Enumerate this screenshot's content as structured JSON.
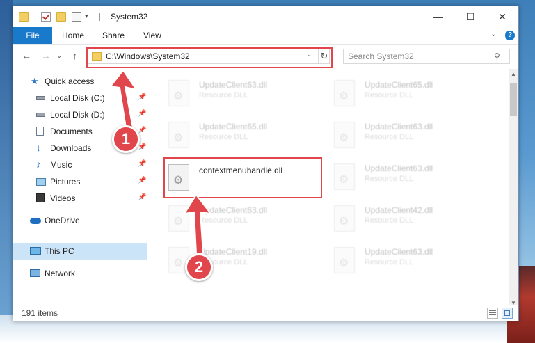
{
  "window": {
    "title": "System32",
    "minimize_icon": "—",
    "maximize_icon": "☐",
    "close_icon": "✕"
  },
  "ribbon": {
    "tabs": [
      "File",
      "Home",
      "Share",
      "View"
    ],
    "expand_icon": "⌄",
    "help_icon": "?"
  },
  "nav": {
    "back_icon": "←",
    "forward_icon": "→",
    "recent_icon": "⌄",
    "up_icon": "↑",
    "address": "C:\\Windows\\System32",
    "address_dropdown_icon": "⌄",
    "refresh_icon": "↻",
    "search_placeholder": "Search System32",
    "search_icon": "⚲"
  },
  "sidebar": {
    "pin_icon": "📌",
    "items": [
      {
        "label": "Quick access",
        "icon": "star-icon"
      },
      {
        "label": "Local Disk (C:)",
        "icon": "drive-icon",
        "pinned": true
      },
      {
        "label": "Local Disk (D:)",
        "icon": "drive-icon",
        "pinned": true
      },
      {
        "label": "Documents",
        "icon": "documents-icon",
        "pinned": true
      },
      {
        "label": "Downloads",
        "icon": "download-icon",
        "pinned": true
      },
      {
        "label": "Music",
        "icon": "music-icon",
        "pinned": true
      },
      {
        "label": "Pictures",
        "icon": "pictures-icon",
        "pinned": true
      },
      {
        "label": "Videos",
        "icon": "videos-icon",
        "pinned": true
      },
      {
        "label": "OneDrive",
        "icon": "cloud-icon"
      },
      {
        "label": "This PC",
        "icon": "computer-icon",
        "selected": true
      },
      {
        "label": "Network",
        "icon": "network-icon"
      }
    ]
  },
  "files": {
    "left": [
      {
        "name": "UpdateClient63.dll",
        "type": "Resource DLL"
      },
      {
        "name": "UpdateClient65.dll",
        "type": "Resource DLL"
      },
      {
        "name": "contextmenuhandle.dll",
        "type": ""
      },
      {
        "name": "UpdateClient63.dll",
        "type": "Resource DLL"
      },
      {
        "name": "UpdateClient19.dll",
        "type": "Resource DLL"
      }
    ],
    "right": [
      {
        "name": "UpdateClient65.dll",
        "type": "Resource DLL"
      },
      {
        "name": "UpdateClient63.dll",
        "type": "Resource DLL"
      },
      {
        "name": "UpdateClient63.dll",
        "type": "Resource DLL"
      },
      {
        "name": "UpdateClient42.dll",
        "type": "Resource DLL"
      },
      {
        "name": "UpdateClient63.dll",
        "type": "Resource DLL"
      }
    ]
  },
  "scroll": {
    "up_icon": "▲",
    "down_icon": "▼"
  },
  "status": {
    "item_count": "191 items"
  },
  "annotations": {
    "step1": "1",
    "step2": "2",
    "color": "#e0464b"
  }
}
